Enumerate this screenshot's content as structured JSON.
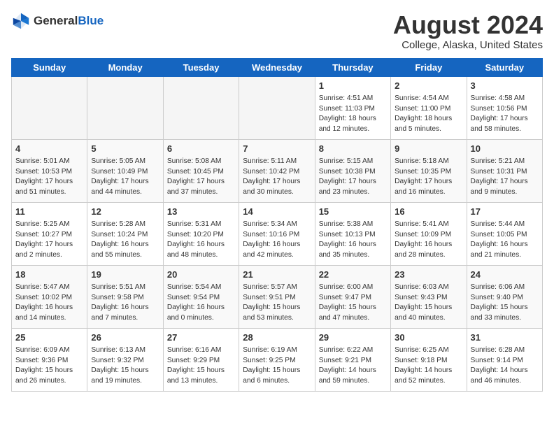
{
  "header": {
    "logo_general": "General",
    "logo_blue": "Blue",
    "month_year": "August 2024",
    "location": "College, Alaska, United States"
  },
  "weekdays": [
    "Sunday",
    "Monday",
    "Tuesday",
    "Wednesday",
    "Thursday",
    "Friday",
    "Saturday"
  ],
  "weeks": [
    [
      {
        "day": "",
        "info": ""
      },
      {
        "day": "",
        "info": ""
      },
      {
        "day": "",
        "info": ""
      },
      {
        "day": "",
        "info": ""
      },
      {
        "day": "1",
        "info": "Sunrise: 4:51 AM\nSunset: 11:03 PM\nDaylight: 18 hours\nand 12 minutes."
      },
      {
        "day": "2",
        "info": "Sunrise: 4:54 AM\nSunset: 11:00 PM\nDaylight: 18 hours\nand 5 minutes."
      },
      {
        "day": "3",
        "info": "Sunrise: 4:58 AM\nSunset: 10:56 PM\nDaylight: 17 hours\nand 58 minutes."
      }
    ],
    [
      {
        "day": "4",
        "info": "Sunrise: 5:01 AM\nSunset: 10:53 PM\nDaylight: 17 hours\nand 51 minutes."
      },
      {
        "day": "5",
        "info": "Sunrise: 5:05 AM\nSunset: 10:49 PM\nDaylight: 17 hours\nand 44 minutes."
      },
      {
        "day": "6",
        "info": "Sunrise: 5:08 AM\nSunset: 10:45 PM\nDaylight: 17 hours\nand 37 minutes."
      },
      {
        "day": "7",
        "info": "Sunrise: 5:11 AM\nSunset: 10:42 PM\nDaylight: 17 hours\nand 30 minutes."
      },
      {
        "day": "8",
        "info": "Sunrise: 5:15 AM\nSunset: 10:38 PM\nDaylight: 17 hours\nand 23 minutes."
      },
      {
        "day": "9",
        "info": "Sunrise: 5:18 AM\nSunset: 10:35 PM\nDaylight: 17 hours\nand 16 minutes."
      },
      {
        "day": "10",
        "info": "Sunrise: 5:21 AM\nSunset: 10:31 PM\nDaylight: 17 hours\nand 9 minutes."
      }
    ],
    [
      {
        "day": "11",
        "info": "Sunrise: 5:25 AM\nSunset: 10:27 PM\nDaylight: 17 hours\nand 2 minutes."
      },
      {
        "day": "12",
        "info": "Sunrise: 5:28 AM\nSunset: 10:24 PM\nDaylight: 16 hours\nand 55 minutes."
      },
      {
        "day": "13",
        "info": "Sunrise: 5:31 AM\nSunset: 10:20 PM\nDaylight: 16 hours\nand 48 minutes."
      },
      {
        "day": "14",
        "info": "Sunrise: 5:34 AM\nSunset: 10:16 PM\nDaylight: 16 hours\nand 42 minutes."
      },
      {
        "day": "15",
        "info": "Sunrise: 5:38 AM\nSunset: 10:13 PM\nDaylight: 16 hours\nand 35 minutes."
      },
      {
        "day": "16",
        "info": "Sunrise: 5:41 AM\nSunset: 10:09 PM\nDaylight: 16 hours\nand 28 minutes."
      },
      {
        "day": "17",
        "info": "Sunrise: 5:44 AM\nSunset: 10:05 PM\nDaylight: 16 hours\nand 21 minutes."
      }
    ],
    [
      {
        "day": "18",
        "info": "Sunrise: 5:47 AM\nSunset: 10:02 PM\nDaylight: 16 hours\nand 14 minutes."
      },
      {
        "day": "19",
        "info": "Sunrise: 5:51 AM\nSunset: 9:58 PM\nDaylight: 16 hours\nand 7 minutes."
      },
      {
        "day": "20",
        "info": "Sunrise: 5:54 AM\nSunset: 9:54 PM\nDaylight: 16 hours\nand 0 minutes."
      },
      {
        "day": "21",
        "info": "Sunrise: 5:57 AM\nSunset: 9:51 PM\nDaylight: 15 hours\nand 53 minutes."
      },
      {
        "day": "22",
        "info": "Sunrise: 6:00 AM\nSunset: 9:47 PM\nDaylight: 15 hours\nand 47 minutes."
      },
      {
        "day": "23",
        "info": "Sunrise: 6:03 AM\nSunset: 9:43 PM\nDaylight: 15 hours\nand 40 minutes."
      },
      {
        "day": "24",
        "info": "Sunrise: 6:06 AM\nSunset: 9:40 PM\nDaylight: 15 hours\nand 33 minutes."
      }
    ],
    [
      {
        "day": "25",
        "info": "Sunrise: 6:09 AM\nSunset: 9:36 PM\nDaylight: 15 hours\nand 26 minutes."
      },
      {
        "day": "26",
        "info": "Sunrise: 6:13 AM\nSunset: 9:32 PM\nDaylight: 15 hours\nand 19 minutes."
      },
      {
        "day": "27",
        "info": "Sunrise: 6:16 AM\nSunset: 9:29 PM\nDaylight: 15 hours\nand 13 minutes."
      },
      {
        "day": "28",
        "info": "Sunrise: 6:19 AM\nSunset: 9:25 PM\nDaylight: 15 hours\nand 6 minutes."
      },
      {
        "day": "29",
        "info": "Sunrise: 6:22 AM\nSunset: 9:21 PM\nDaylight: 14 hours\nand 59 minutes."
      },
      {
        "day": "30",
        "info": "Sunrise: 6:25 AM\nSunset: 9:18 PM\nDaylight: 14 hours\nand 52 minutes."
      },
      {
        "day": "31",
        "info": "Sunrise: 6:28 AM\nSunset: 9:14 PM\nDaylight: 14 hours\nand 46 minutes."
      }
    ]
  ]
}
